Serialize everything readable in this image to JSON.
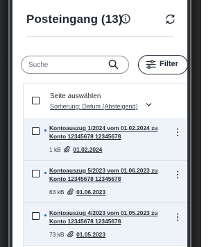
{
  "header": {
    "title": "Posteingang (13)"
  },
  "search": {
    "placeholder": "Suche"
  },
  "filter": {
    "label": "Filter"
  },
  "list": {
    "select_all_label": "Seite auswählen",
    "sort_label": "Sortierung: Datum (Absteigend)",
    "items": [
      {
        "subject_line1": "Kontoauszug 1/2024 vom 01.02.2024 zu",
        "subject_line2": "Konto 12345678 12345678",
        "size": "1 kB",
        "date": "01.02.2024"
      },
      {
        "subject_line1": "Kontoauszug 5/2023 vom 01.06.2023 zu",
        "subject_line2": "Konto 12345678 12345678",
        "size": "63 kB",
        "date": "01.06.2023"
      },
      {
        "subject_line1": "Kontoauszug 4/2023 vom 01.05.2023 zu",
        "subject_line2": "Konto 12345678 12345678",
        "size": "73 kB",
        "date": "01.05.2023"
      }
    ]
  },
  "colors": {
    "accent": "#1a5fb4",
    "row_background": "#eef3fa",
    "text": "#1f2933"
  },
  "icons": [
    "info-icon",
    "refresh-icon",
    "search-icon",
    "filter-icon",
    "chevron-down-icon",
    "paperclip-icon",
    "more-vertical-icon"
  ]
}
